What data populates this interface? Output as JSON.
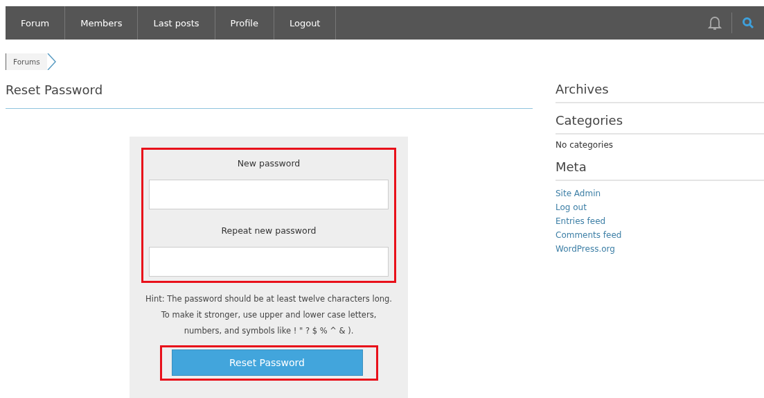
{
  "nav": {
    "items": [
      {
        "label": "Forum"
      },
      {
        "label": "Members"
      },
      {
        "label": "Last posts"
      },
      {
        "label": "Profile"
      },
      {
        "label": "Logout"
      }
    ]
  },
  "breadcrumb": {
    "label": "Forums"
  },
  "page_title": "Reset Password",
  "form": {
    "fields_highlighted": true,
    "fields": [
      {
        "label": "New password"
      },
      {
        "label": "Repeat new password"
      }
    ],
    "hint": [
      "Hint: The password should be at least twelve characters long.",
      "To make it stronger, use upper and lower case letters,",
      "numbers, and symbols like ! \" ? $ % ^ & )."
    ],
    "button": {
      "label": "Reset Password",
      "highlighted": true
    }
  },
  "sidebar": {
    "widgets": [
      {
        "title": "Archives"
      },
      {
        "title": "Categories",
        "text": "No categories"
      },
      {
        "title": "Meta",
        "links": [
          "Site Admin",
          "Log out",
          "Entries feed",
          "Comments feed",
          "WordPress.org"
        ]
      }
    ]
  }
}
